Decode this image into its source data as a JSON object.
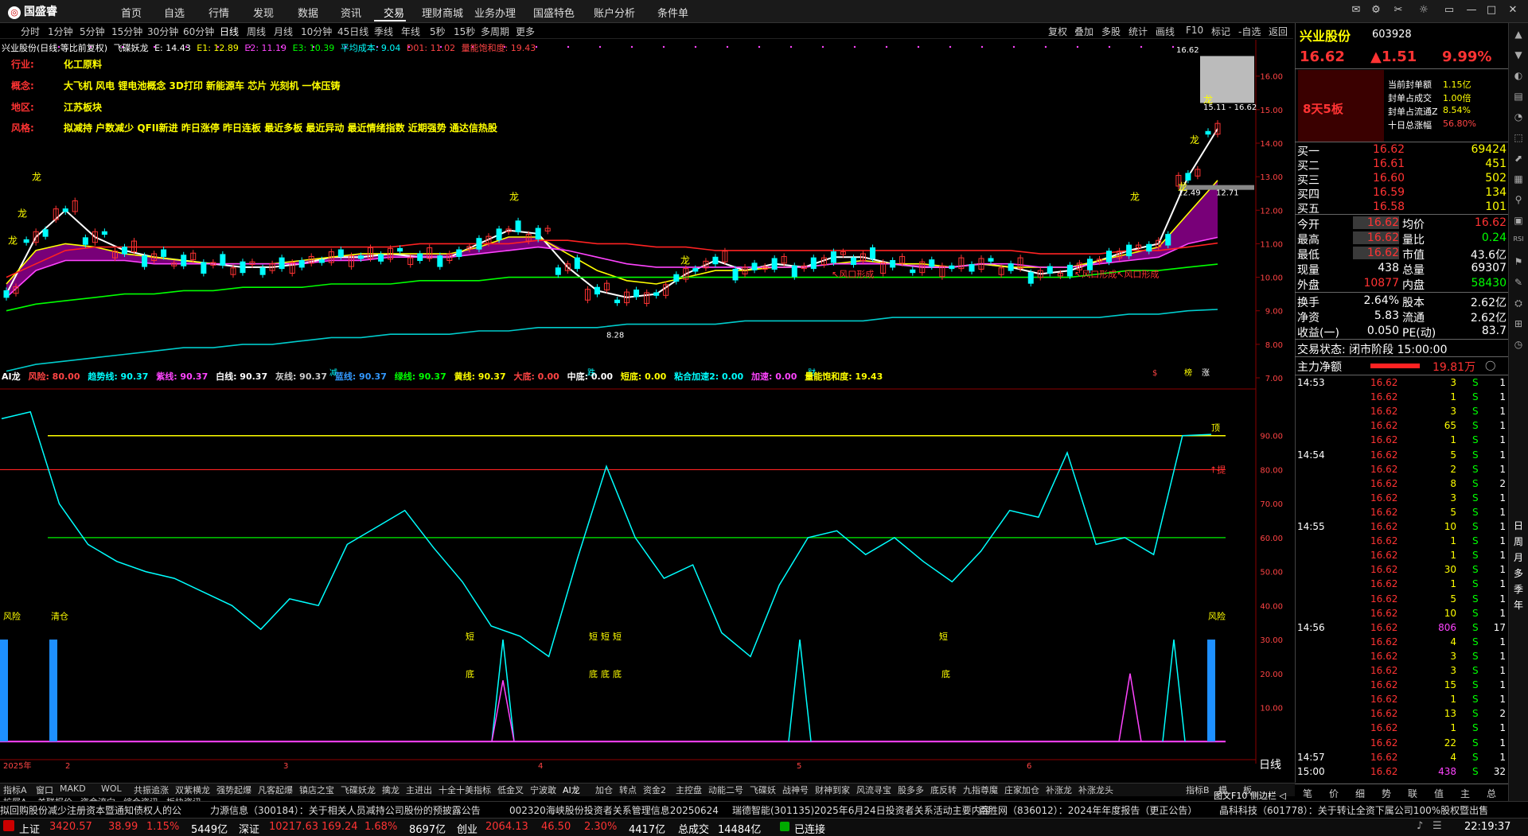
{
  "app": {
    "logo": "国盛睿"
  },
  "menu": [
    "首页",
    "自选",
    "行情",
    "发现",
    "数据",
    "资讯",
    "交易",
    "理财商城",
    "业务办理",
    "国盛特色",
    "账户分析",
    "条件单"
  ],
  "periods": [
    "分时",
    "1分钟",
    "5分钟",
    "15分钟",
    "30分钟",
    "60分钟",
    "日线",
    "周线",
    "月线",
    "10分钟",
    "45日线",
    "季线",
    "年线",
    "5秒",
    "15秒",
    "多周期",
    "更多"
  ],
  "tools": [
    "复权",
    "叠加",
    "多股",
    "统计",
    "画线",
    "F10",
    "标记",
    "-自选",
    "返回"
  ],
  "legend": {
    "title": "兴业股份(日线,等比前复权)",
    "indicator": "飞碟妖龙",
    "e": "E: 14.43",
    "e1": "E1: 12.89",
    "e2": "E2: 11.19",
    "e3": "E3: 10.39",
    "avg": "平均成本: 9.04",
    "d01": "D01: 11.02",
    "satur": "量能饱和度: 19.43"
  },
  "info": {
    "industry_label": "行业:",
    "industry": "化工原料",
    "concept_label": "概念:",
    "concept": "大飞机 风电 锂电池概念 3D打印 新能源车 芯片 光刻机 一体压铸",
    "region_label": "地区:",
    "region": "江苏板块",
    "style_label": "风格:",
    "style": "拟减持 户数减少 QFII新进 昨日涨停 昨日连板 最近多板 最近异动 最近情绪指数 近期强势 通达信热股"
  },
  "price_axis": [
    "16.00",
    "15.00",
    "14.00",
    "13.00",
    "12.00",
    "11.00",
    "10.00",
    "9.00",
    "8.00",
    "7.00"
  ],
  "price_labels": {
    "high": "16.62",
    "range": "15.11 - 16.62",
    "mid": "12.49",
    "mid2": "12.71",
    "low": "8.28"
  },
  "dragon": "龙",
  "fengkou": "风口形成",
  "markers": [
    "减",
    "跌",
    "财",
    "$",
    "榜",
    "涨"
  ],
  "ind_legend": {
    "name": "AI龙",
    "risk": "风险: 80.00",
    "trend": "趋势线: 90.37",
    "purple": "紫线: 90.37",
    "white": "白线: 90.37",
    "gray": "灰线: 90.37",
    "blue": "蓝线: 90.37",
    "green": "绿线: 90.37",
    "yellow": "黄线: 90.37",
    "bigbottom": "大底: 0.00",
    "midbottom": "中底: 0.00",
    "shortbottom": "短底: 0.00",
    "accel2": "粘合加速2: 0.00",
    "accel": "加速: 0.00",
    "satur": "量能饱和度: 19.43"
  },
  "ind_axis": [
    "90.00",
    "80.00",
    "70.00",
    "60.00",
    "50.00",
    "40.00",
    "30.00",
    "20.00",
    "10.00"
  ],
  "ind_marks": {
    "top": "顶",
    "alarm": "↑提",
    "risk": "风险",
    "clear": "清仓",
    "short": "短",
    "bottom": "底"
  },
  "xaxis": [
    "2025年",
    "2",
    "3",
    "4",
    "5",
    "6"
  ],
  "chart_data": {
    "type": "line",
    "title": "兴业股份(日线,等比前复权)",
    "xlabel": "",
    "ylabel": "",
    "ylim": [
      7,
      16.8
    ],
    "series": [
      {
        "name": "E",
        "values": [
          9.5,
          11.2,
          12.0,
          11.2,
          10.8,
          10.6,
          10.5,
          10.4,
          10.3,
          10.3,
          10.4,
          10.6,
          10.6,
          10.7,
          10.6,
          10.6,
          11.0,
          11.4,
          11.3,
          10.3,
          9.6,
          9.4,
          9.5,
          10.1,
          10.5,
          10.2,
          10.4,
          10.3,
          10.6,
          10.6,
          10.4,
          10.3,
          10.3,
          10.4,
          10.3,
          10.1,
          10.2,
          10.5,
          10.8,
          11.0,
          13.0,
          14.43
        ]
      },
      {
        "name": "E1",
        "values": [
          9.8,
          10.8,
          11.0,
          10.9,
          10.7,
          10.6,
          10.5,
          10.4,
          10.4,
          10.4,
          10.5,
          10.6,
          10.7,
          10.7,
          10.7,
          10.7,
          10.9,
          11.2,
          11.2,
          10.7,
          10.2,
          9.9,
          9.8,
          10.0,
          10.2,
          10.2,
          10.3,
          10.3,
          10.4,
          10.5,
          10.4,
          10.4,
          10.3,
          10.4,
          10.3,
          10.3,
          10.3,
          10.5,
          10.7,
          10.9,
          11.9,
          12.89
        ]
      },
      {
        "name": "E2",
        "values": [
          9.4,
          10.2,
          10.5,
          10.5,
          10.5,
          10.4,
          10.4,
          10.4,
          10.4,
          10.4,
          10.4,
          10.5,
          10.5,
          10.6,
          10.6,
          10.6,
          10.7,
          10.8,
          10.9,
          10.8,
          10.6,
          10.4,
          10.3,
          10.3,
          10.3,
          10.3,
          10.3,
          10.3,
          10.4,
          10.4,
          10.4,
          10.3,
          10.3,
          10.4,
          10.4,
          10.3,
          10.3,
          10.4,
          10.5,
          10.6,
          11.0,
          11.19
        ]
      },
      {
        "name": "E3",
        "values": [
          9.0,
          9.2,
          9.3,
          9.4,
          9.5,
          9.5,
          9.6,
          9.6,
          9.7,
          9.7,
          9.7,
          9.8,
          9.8,
          9.8,
          9.9,
          9.9,
          9.9,
          10.0,
          10.0,
          10.0,
          10.0,
          10.0,
          10.0,
          10.0,
          10.0,
          10.0,
          10.0,
          10.0,
          10.0,
          10.0,
          10.0,
          10.0,
          10.0,
          10.0,
          10.0,
          10.0,
          10.0,
          10.1,
          10.2,
          10.2,
          10.3,
          10.39
        ]
      },
      {
        "name": "平均成本",
        "values": [
          7.2,
          7.4,
          7.5,
          7.6,
          7.7,
          7.8,
          7.9,
          7.9,
          8.0,
          8.0,
          8.1,
          8.2,
          8.2,
          8.3,
          8.3,
          8.3,
          8.4,
          8.4,
          8.5,
          8.5,
          8.5,
          8.6,
          8.6,
          8.6,
          8.6,
          8.7,
          8.7,
          8.7,
          8.7,
          8.7,
          8.8,
          8.8,
          8.8,
          8.8,
          8.8,
          8.8,
          8.8,
          8.8,
          8.9,
          8.9,
          9.0,
          9.04
        ]
      },
      {
        "name": "D01",
        "values": [
          10.0,
          10.4,
          10.8,
          10.9,
          10.9,
          10.9,
          10.9,
          10.9,
          10.9,
          10.9,
          10.9,
          10.9,
          10.9,
          10.9,
          11.0,
          11.0,
          11.0,
          11.0,
          11.1,
          11.1,
          11.0,
          11.0,
          10.9,
          10.9,
          10.8,
          10.8,
          10.8,
          10.8,
          10.8,
          10.8,
          10.8,
          10.8,
          10.8,
          10.8,
          10.8,
          10.7,
          10.7,
          10.7,
          10.8,
          10.8,
          10.9,
          11.02
        ]
      }
    ],
    "ind_series": [
      {
        "name": "趋势线",
        "values": [
          95,
          97,
          70,
          58,
          53,
          50,
          48,
          44,
          40,
          33,
          42,
          40,
          58,
          63,
          68,
          57,
          47,
          34,
          31,
          25,
          54,
          81,
          60,
          48,
          52,
          32,
          25,
          46,
          60,
          62,
          55,
          60,
          53,
          47,
          56,
          68,
          66,
          85,
          58,
          60,
          55,
          90,
          90.37
        ]
      }
    ]
  },
  "right": {
    "name": "兴业股份",
    "code": "603928",
    "price": "16.62",
    "change": "▲1.51",
    "pct": "9.99%",
    "streak": "8天5板",
    "seal": [
      {
        "k": "当前封单额",
        "v": "1.15亿"
      },
      {
        "k": "封单占成交",
        "v": "1.00倍"
      },
      {
        "k": "封单占流通Z",
        "v": "8.54%"
      },
      {
        "k": "十日总涨幅",
        "v": "56.80%"
      }
    ],
    "bids": [
      {
        "k": "买一",
        "p": "16.62",
        "v": "69424"
      },
      {
        "k": "买二",
        "p": "16.61",
        "v": "451"
      },
      {
        "k": "买三",
        "p": "16.60",
        "v": "502"
      },
      {
        "k": "买四",
        "p": "16.59",
        "v": "134"
      },
      {
        "k": "买五",
        "p": "16.58",
        "v": "101"
      }
    ],
    "stats": [
      {
        "k": "今开",
        "v": "16.62",
        "k2": "均价",
        "v2": "16.62"
      },
      {
        "k": "最高",
        "v": "16.62",
        "k2": "量比",
        "v2": "0.24"
      },
      {
        "k": "最低",
        "v": "16.62",
        "k2": "市值",
        "v2": "43.6亿"
      },
      {
        "k": "现量",
        "v": "438",
        "k2": "总量",
        "v2": "69307"
      },
      {
        "k": "外盘",
        "v": "10877",
        "k2": "内盘",
        "v2": "58430"
      }
    ],
    "stats2": [
      {
        "k": "换手",
        "v": "2.64%",
        "k2": "股本",
        "v2": "2.62亿"
      },
      {
        "k": "净资",
        "v": "5.83",
        "k2": "流通",
        "v2": "2.62亿"
      },
      {
        "k": "收益(一)",
        "v": "0.050",
        "k2": "PE(动)",
        "v2": "83.7"
      }
    ],
    "trade_state": "交易状态: 闭市阶段 15:00:00",
    "main_flow_label": "主力净额",
    "main_flow": "19.81万",
    "ticks": [
      {
        "t": "14:53",
        "p": "16.62",
        "v": "3",
        "s": "S",
        "n": "1"
      },
      {
        "t": "",
        "p": "16.62",
        "v": "1",
        "s": "S",
        "n": "1"
      },
      {
        "t": "",
        "p": "16.62",
        "v": "3",
        "s": "S",
        "n": "1"
      },
      {
        "t": "",
        "p": "16.62",
        "v": "65",
        "s": "S",
        "n": "1"
      },
      {
        "t": "",
        "p": "16.62",
        "v": "1",
        "s": "S",
        "n": "1"
      },
      {
        "t": "14:54",
        "p": "16.62",
        "v": "5",
        "s": "S",
        "n": "1"
      },
      {
        "t": "",
        "p": "16.62",
        "v": "2",
        "s": "S",
        "n": "1"
      },
      {
        "t": "",
        "p": "16.62",
        "v": "8",
        "s": "S",
        "n": "2"
      },
      {
        "t": "",
        "p": "16.62",
        "v": "3",
        "s": "S",
        "n": "1"
      },
      {
        "t": "",
        "p": "16.62",
        "v": "5",
        "s": "S",
        "n": "1"
      },
      {
        "t": "14:55",
        "p": "16.62",
        "v": "10",
        "s": "S",
        "n": "1"
      },
      {
        "t": "",
        "p": "16.62",
        "v": "1",
        "s": "S",
        "n": "1"
      },
      {
        "t": "",
        "p": "16.62",
        "v": "1",
        "s": "S",
        "n": "1"
      },
      {
        "t": "",
        "p": "16.62",
        "v": "30",
        "s": "S",
        "n": "1"
      },
      {
        "t": "",
        "p": "16.62",
        "v": "1",
        "s": "S",
        "n": "1"
      },
      {
        "t": "",
        "p": "16.62",
        "v": "5",
        "s": "S",
        "n": "1"
      },
      {
        "t": "",
        "p": "16.62",
        "v": "10",
        "s": "S",
        "n": "1"
      },
      {
        "t": "14:56",
        "p": "16.62",
        "v": "806",
        "s": "S",
        "n": "17"
      },
      {
        "t": "",
        "p": "16.62",
        "v": "4",
        "s": "S",
        "n": "1"
      },
      {
        "t": "",
        "p": "16.62",
        "v": "3",
        "s": "S",
        "n": "1"
      },
      {
        "t": "",
        "p": "16.62",
        "v": "3",
        "s": "S",
        "n": "1"
      },
      {
        "t": "",
        "p": "16.62",
        "v": "15",
        "s": "S",
        "n": "1"
      },
      {
        "t": "",
        "p": "16.62",
        "v": "1",
        "s": "S",
        "n": "1"
      },
      {
        "t": "",
        "p": "16.62",
        "v": "13",
        "s": "S",
        "n": "2"
      },
      {
        "t": "",
        "p": "16.62",
        "v": "1",
        "s": "S",
        "n": "1"
      },
      {
        "t": "",
        "p": "16.62",
        "v": "22",
        "s": "S",
        "n": "1"
      },
      {
        "t": "14:57",
        "p": "16.62",
        "v": "4",
        "s": "S",
        "n": "1"
      },
      {
        "t": "15:00",
        "p": "16.62",
        "v": "438",
        "s": "S",
        "n": "32"
      }
    ],
    "bottom_tabs": [
      "笔",
      "价",
      "细",
      "势",
      "联",
      "值",
      "主",
      "总"
    ]
  },
  "tabs": [
    "指标A",
    "窗口",
    "MAKD",
    "WOL",
    "共振追涨",
    "双紫横龙",
    "强势起爆",
    "凡客起爆",
    "镇店之宝",
    "飞碟妖龙",
    "擒龙",
    "主进出",
    "十全十美指标",
    "低金叉",
    "宁波敢",
    "AI龙",
    "加仓",
    "转点",
    "资金2",
    "主控盘",
    "动能二号",
    "飞碟妖",
    "战神号",
    "财神到家",
    "风流寻宝",
    "股多多",
    "底反转",
    "九指尊魔",
    "庄家加仓",
    "补涨龙",
    "补涨龙头",
    "指标B",
    "模",
    "板"
  ],
  "tabs2": [
    "扩展A",
    "关联报价",
    "资金流向",
    "综合资讯",
    "板块资讯"
  ],
  "daily_label": "日线",
  "tuwen": "图文F10 侧边栏 ◁",
  "news": [
    "拟回购股份减少注册资本暨通知债权人的公",
    "力源信息（300184）：关于相关人员减持公司股份的预披露公告",
    "002320海峡股份投资者关系管理信息20250624",
    "瑞德智能(301135)2025年6月24日投资者关系活动主要内容",
    "百胜网（836012）：2024年年度报告（更正公告）",
    "晶科科技（601778）：关于转让全资下属公司100%股权暨出售"
  ],
  "status": {
    "sh": "上证",
    "sh_v": "3420.57",
    "sh_c": "38.99",
    "sh_p": "1.15%",
    "sh_a": "5449亿",
    "sz": "深证",
    "sz_v": "10217.63",
    "sz_c": "169.24",
    "sz_p": "1.68%",
    "sz_a": "8697亿",
    "cy": "创业",
    "cy_v": "2064.13",
    "cy_c": "46.50",
    "cy_p": "2.30%",
    "cy_a": "4417亿",
    "total": "总成交",
    "total_v": "14484亿",
    "conn": "已连接",
    "time": "22:19:37"
  },
  "colors": {
    "up": "#ff3333",
    "down": "#00ffff",
    "yellow": "#ffff00",
    "magenta": "#ff00ff",
    "green": "#00ff00"
  }
}
